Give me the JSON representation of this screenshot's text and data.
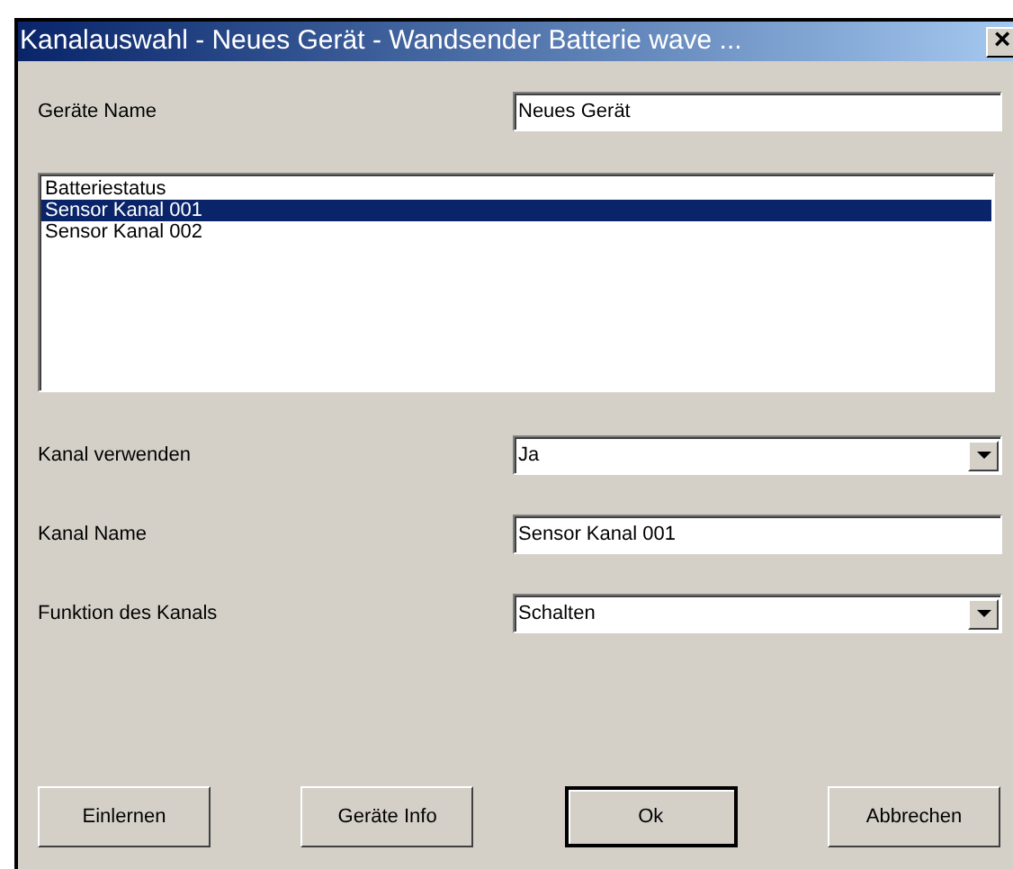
{
  "window": {
    "title": "Kanalauswahl - Neues Gerät - Wandsender Batterie wave ...",
    "close": "×"
  },
  "device_name": {
    "label": "Geräte Name",
    "value": "Neues Gerät"
  },
  "channels": [
    {
      "label": "Batteriestatus",
      "selected": false
    },
    {
      "label": "Sensor Kanal 001",
      "selected": true
    },
    {
      "label": "Sensor Kanal 002",
      "selected": false
    }
  ],
  "fields": [
    {
      "kind": "dropdown",
      "label": "Kanal verwenden",
      "value": "Ja"
    },
    {
      "kind": "text",
      "label": "Kanal Name",
      "value": "Sensor Kanal 001"
    },
    {
      "kind": "dropdown",
      "label": "Funktion des Kanals",
      "value": "Schalten"
    }
  ],
  "buttons": [
    {
      "label": "Einlernen",
      "default": false
    },
    {
      "label": "Geräte Info",
      "default": false
    },
    {
      "label": "Ok",
      "default": true
    },
    {
      "label": "Abbrechen",
      "default": false
    }
  ]
}
